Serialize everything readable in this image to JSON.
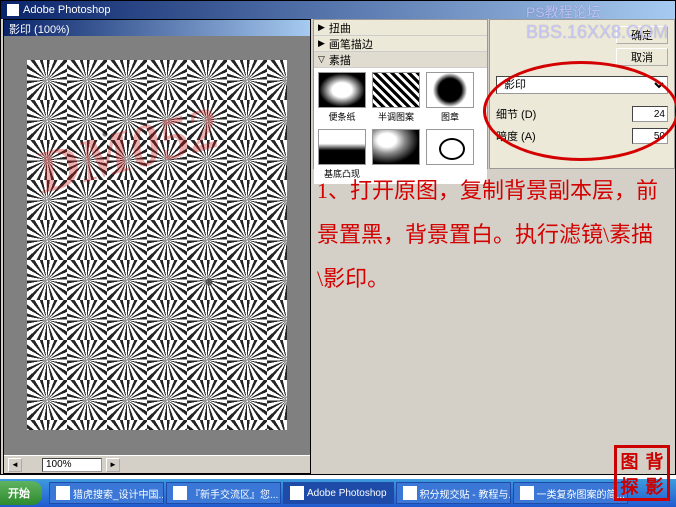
{
  "app": {
    "title": "Adobe Photoshop"
  },
  "document": {
    "title": "影印 (100%)",
    "zoom": "100%"
  },
  "watermark": {
    "line1": "PS教程论坛",
    "line2": "BBS.16XX8.COM"
  },
  "filter_categories": [
    {
      "label": "扭曲",
      "expanded": false
    },
    {
      "label": "画笔描边",
      "expanded": false
    },
    {
      "label": "素描",
      "expanded": true
    }
  ],
  "filter_thumbs": [
    {
      "label": "便条纸",
      "selected": false
    },
    {
      "label": "半调图案",
      "selected": false
    },
    {
      "label": "图章",
      "selected": false
    },
    {
      "label": "基底凸现",
      "selected": false
    },
    {
      "label": "",
      "selected": false
    },
    {
      "label": "",
      "selected": false
    }
  ],
  "settings": {
    "ok_button": "确定",
    "cancel_button": "取消",
    "filter_name": "影印",
    "params": [
      {
        "label": "细节 (D)",
        "value": "24"
      },
      {
        "label": "暗度 (A)",
        "value": "50"
      }
    ]
  },
  "instructions": "1、打开原图，复制背景副本层，前景置黑，背景置白。执行滤镜\\素描\\影印。",
  "canvas_watermark": "DM052",
  "stamp_chars": [
    "图",
    "背",
    "探",
    "影"
  ],
  "taskbar": {
    "start": "开始",
    "items": [
      "猎虎搜索_设计中国...",
      "『新手交流区』您...",
      "Adobe Photoshop",
      "积分规交贴 - 教程与...",
      "一类复杂图案的简..."
    ],
    "active_index": 2
  }
}
